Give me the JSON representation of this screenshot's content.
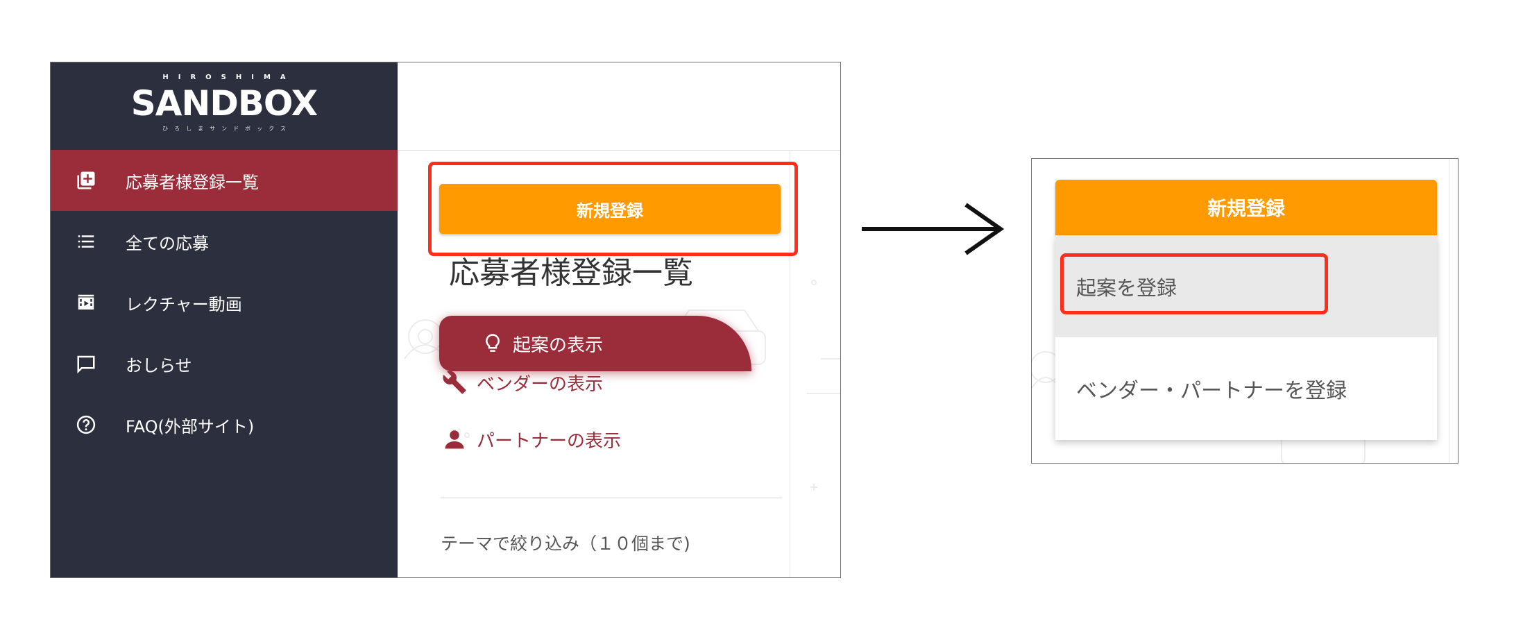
{
  "left_screen": {
    "logo": {
      "top_text": "HIROSHIMA",
      "main_text": "SANDBOX",
      "kana_text": "ひろしまサンドボックス"
    },
    "sidebar": {
      "items": [
        {
          "label": "応募者様登録一覧",
          "icon": "add-box-icon",
          "active": true
        },
        {
          "label": "全ての応募",
          "icon": "list-icon",
          "active": false
        },
        {
          "label": "レクチャー動画",
          "icon": "movie-icon",
          "active": false
        },
        {
          "label": "おしらせ",
          "icon": "chat-bubble-icon",
          "active": false
        },
        {
          "label": "FAQ(外部サイト)",
          "icon": "help-circle-icon",
          "active": false
        }
      ]
    },
    "new_button_label": "新規登録",
    "page_title": "応募者様登録一覧",
    "tabs": {
      "ideas": "起案の表示",
      "vendors": "ベンダーの表示",
      "partners": "パートナーの表示"
    },
    "theme_filter_label": "テーマで絞り込み（１０個まで)"
  },
  "right_screen": {
    "new_button_label": "新規登録",
    "dropdown": {
      "register_idea": "起案を登録",
      "register_vendor_partner": "ベンダー・パートナーを登録"
    }
  },
  "colors": {
    "sidebar_bg": "#2c303e",
    "active_bg": "#9b2d3a",
    "accent_orange": "#ff9a00",
    "highlight_red": "#ff2d1a"
  }
}
